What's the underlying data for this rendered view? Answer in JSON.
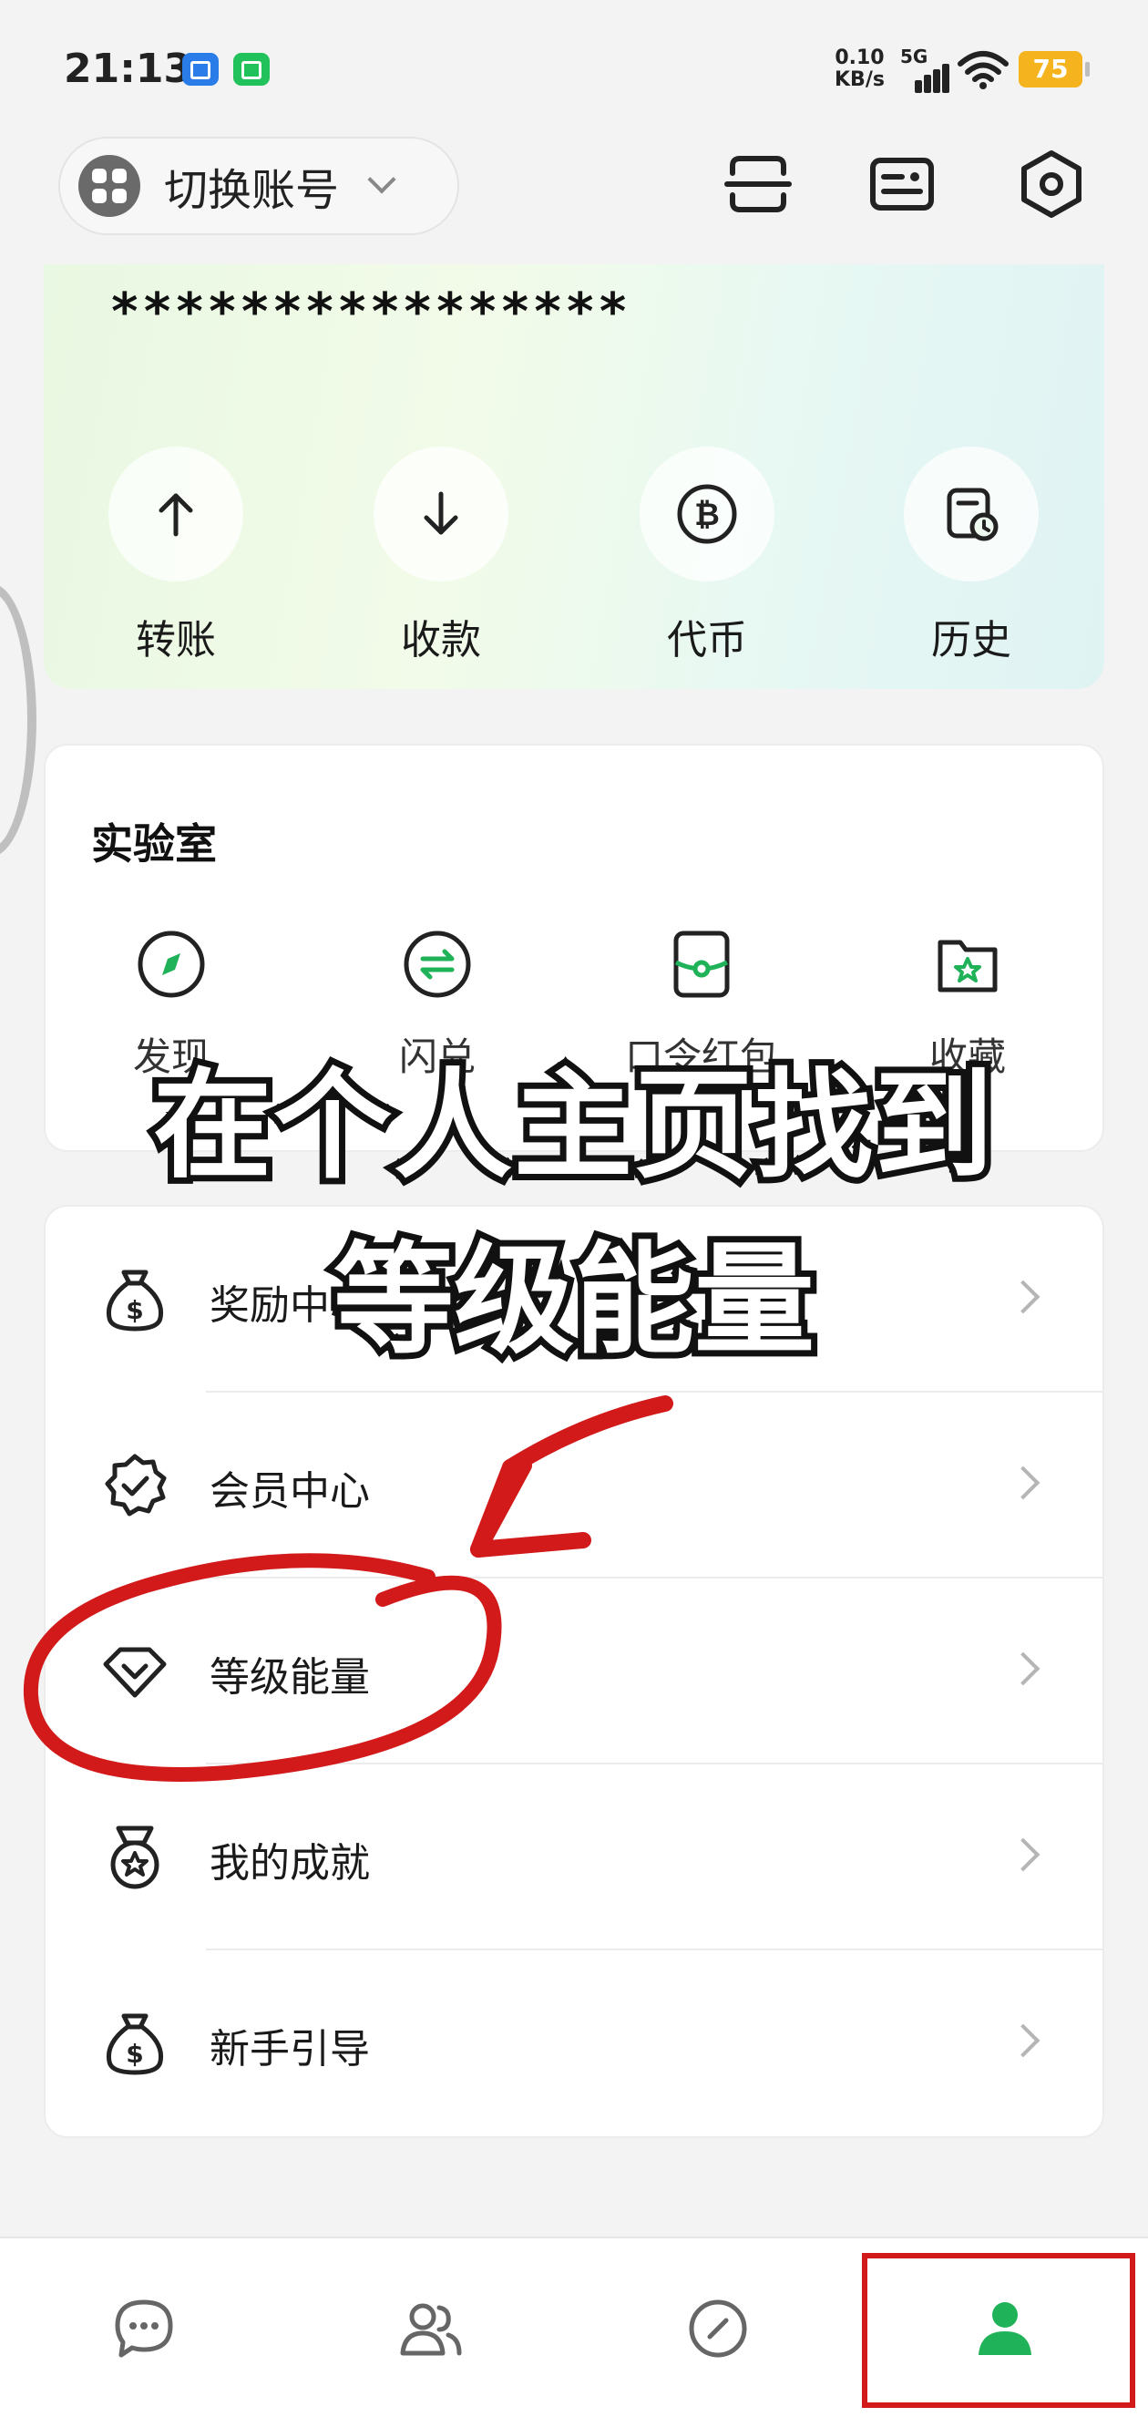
{
  "status_bar": {
    "time": "21:13",
    "net_speed_value": "0.10",
    "net_speed_unit": "KB/s",
    "network_type": "5G",
    "battery": "75"
  },
  "header": {
    "account_switch_label": "切换账号",
    "scan_icon": "scan-icon",
    "card_icon": "id-card-icon",
    "settings_icon": "settings-hexagon-icon"
  },
  "wallet": {
    "masked_address": "****************",
    "actions": [
      {
        "label": "转账",
        "icon": "arrow-up-icon"
      },
      {
        "label": "收款",
        "icon": "arrow-down-icon"
      },
      {
        "label": "代币",
        "icon": "bitcoin-icon"
      },
      {
        "label": "历史",
        "icon": "history-icon"
      }
    ]
  },
  "lab": {
    "title": "实验室",
    "items": [
      {
        "label": "发现",
        "icon": "compass-icon"
      },
      {
        "label": "闪兑",
        "icon": "swap-icon"
      },
      {
        "label": "口令红包",
        "icon": "red-packet-icon"
      },
      {
        "label": "收藏",
        "icon": "favorites-folder-icon"
      }
    ]
  },
  "menu": {
    "items": [
      {
        "label": "奖励中心",
        "icon": "money-bag-icon"
      },
      {
        "label": "会员中心",
        "icon": "verified-badge-icon"
      },
      {
        "label": "等级能量",
        "icon": "level-heart-icon"
      },
      {
        "label": "我的成就",
        "icon": "medal-icon"
      },
      {
        "label": "新手引导",
        "icon": "money-bag-icon"
      }
    ]
  },
  "overlay": {
    "caption_line1": "在个人主页找到",
    "caption_line2": "等级能量",
    "highlight_color": "#d21a1a"
  },
  "bottom_nav": {
    "tabs": [
      "chat-icon",
      "contacts-icon",
      "discover-icon",
      "profile-icon"
    ],
    "active_tab": "profile-icon"
  },
  "colors": {
    "accent": "#1fb259",
    "annotation_red": "#d21a1a"
  }
}
